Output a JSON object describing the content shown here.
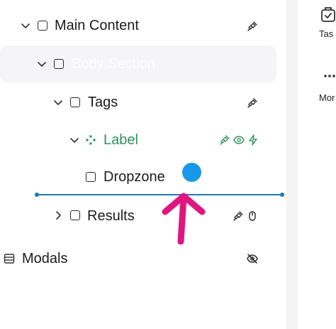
{
  "tree": {
    "rows": [
      {
        "label": "Main Content",
        "icons": [
          "unlink-icon"
        ]
      },
      {
        "label": "Body Section",
        "icons": []
      },
      {
        "label": "Tags",
        "icons": [
          "unlink-icon"
        ]
      },
      {
        "label": "Label",
        "icons": [
          "unlink-icon",
          "eye-icon",
          "bolt-icon"
        ]
      },
      {
        "label": "Dropzone",
        "icons": []
      },
      {
        "label": "Results",
        "icons": [
          "unlink-icon",
          "mouse-icon"
        ]
      },
      {
        "label": "Modals",
        "icons": [
          "eye-off-icon"
        ]
      }
    ]
  },
  "right_panel": {
    "items": [
      {
        "label": "Tas",
        "icon": "task-icon"
      },
      {
        "label": "Mor",
        "icon": "more-icon"
      }
    ]
  },
  "colors": {
    "selected_bg": "#f5f5f7",
    "component_green": "#2d9160",
    "drop_indicator": "#1f78b4",
    "cursor_dot": "#1a98e8",
    "annotation_arrow": "#e0157f"
  }
}
